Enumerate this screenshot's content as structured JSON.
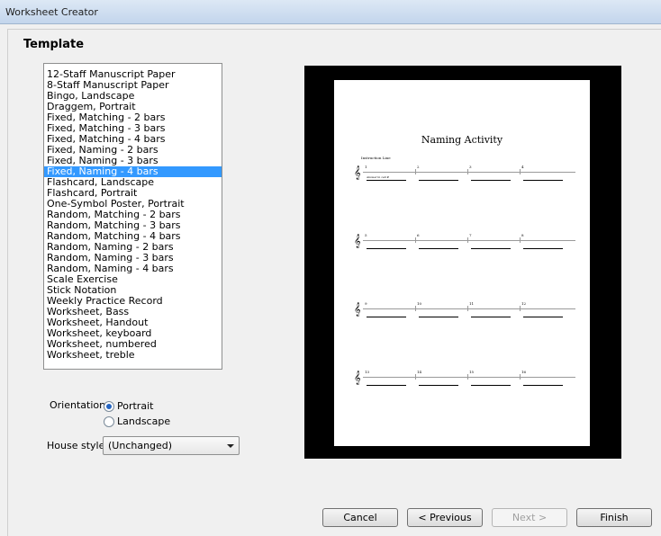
{
  "window": {
    "title": "Worksheet Creator"
  },
  "section": {
    "title": "Template"
  },
  "templates": {
    "items": [
      "12-Staff Manuscript Paper",
      "8-Staff Manuscript Paper",
      "Bingo, Landscape",
      "Draggem, Portrait",
      "Fixed, Matching - 2 bars",
      "Fixed, Matching - 3 bars",
      "Fixed, Matching - 4 bars",
      "Fixed, Naming - 2 bars",
      "Fixed, Naming - 3 bars",
      "Fixed, Naming - 4 bars",
      "Flashcard, Landscape",
      "Flashcard, Portrait",
      "One-Symbol Poster, Portrait",
      "Random, Matching - 2 bars",
      "Random, Matching - 3 bars",
      "Random, Matching - 4 bars",
      "Random, Naming - 2 bars",
      "Random, Naming - 3 bars",
      "Random, Naming - 4 bars",
      "Scale Exercise",
      "Stick Notation",
      "Weekly Practice Record",
      "Worksheet, Bass",
      "Worksheet, Handout",
      "Worksheet, keyboard",
      "Worksheet, numbered",
      "Worksheet, treble"
    ],
    "selected": "Fixed, Naming - 4 bars"
  },
  "orientation": {
    "label": "Orientation:",
    "portrait": "Portrait",
    "landscape": "Landscape",
    "selected": "Portrait"
  },
  "house_style": {
    "label": "House style:",
    "value": "(Unchanged)"
  },
  "preview": {
    "title": "Naming Activity",
    "instruction": "Instruction Line",
    "answer_hint": "Answer in cell #",
    "clef_glyph": "𝄞",
    "rows": [
      [
        "1",
        "2",
        "3",
        "4"
      ],
      [
        "5",
        "6",
        "7",
        "8"
      ],
      [
        "9",
        "10",
        "11",
        "12"
      ],
      [
        "13",
        "14",
        "15",
        "16"
      ]
    ]
  },
  "buttons": {
    "cancel": "Cancel",
    "previous": "< Previous",
    "next": "Next >",
    "finish": "Finish"
  }
}
